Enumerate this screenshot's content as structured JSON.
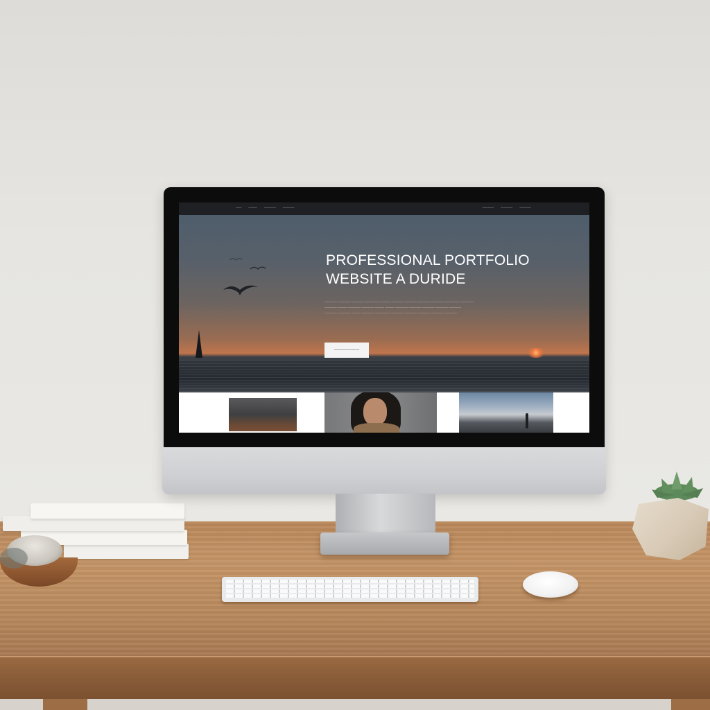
{
  "website": {
    "nav": {
      "left_links": [
        "——",
        "———",
        "————",
        "————"
      ],
      "right_links": [
        "————",
        "————",
        "————"
      ]
    },
    "hero": {
      "title_line1": "PROFESSIONAL PORTFOLIO",
      "title_line2": "WEBSITE A DURIDE",
      "body_text_lines": [
        "———— ———— ———— ————— ——— ———— ———— ———— ———— ————— ————",
        "———— ——— ———— ———— ——— ——— ———— ———— ———— ———— ————",
        "———— ———— ——— ———— ————— ———— ———— ———— ———— ————"
      ],
      "cta_label": "———————",
      "colors": {
        "sky_top": "#4f5e6c",
        "sunset": "#c0754c",
        "sea": "#2b3038"
      }
    },
    "thumbnails": [
      {
        "subject": "dark interior photo"
      },
      {
        "subject": "portrait of woman with curly hair"
      },
      {
        "subject": "beach with lone figure"
      }
    ]
  },
  "scene": {
    "objects": [
      "monitor",
      "keyboard",
      "mouse",
      "book-stack",
      "succulent-plant",
      "wooden-bowl",
      "wooden-desk"
    ]
  }
}
